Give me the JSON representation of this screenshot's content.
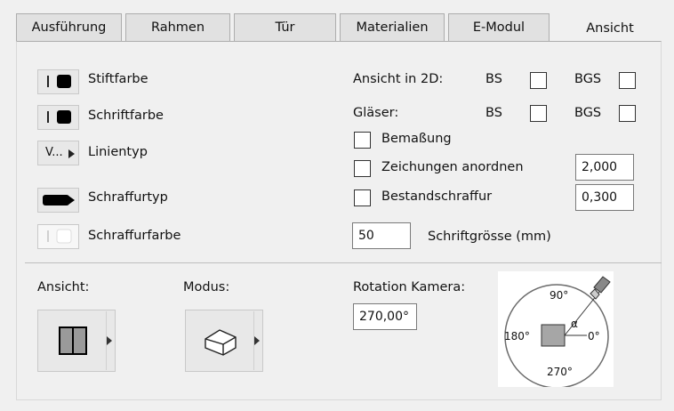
{
  "tabs": [
    {
      "label": "Ausführung"
    },
    {
      "label": "Rahmen"
    },
    {
      "label": "Tür"
    },
    {
      "label": "Materialien"
    },
    {
      "label": "E-Modul"
    },
    {
      "label": "Ansicht",
      "active": true
    }
  ],
  "left": {
    "pen_color": "Stiftfarbe",
    "font_color": "Schriftfarbe",
    "line_type_button": "V...",
    "line_type": "Linientyp",
    "hatch_type": "Schraffurtyp",
    "hatch_color": "Schraffurfarbe"
  },
  "right": {
    "view_2d_label": "Ansicht in 2D:",
    "glass_label": "Gläser:",
    "bs": "BS",
    "bgs": "BGS",
    "dimension": "Bemaßung",
    "arrange_drawings": "Zeichungen anordnen",
    "existing_hatch": "Bestandschraffur",
    "arrange_value": "2,000",
    "hatch_value": "0,300",
    "font_size_value": "50",
    "font_size_label": "Schriftgrösse (mm)"
  },
  "bottom": {
    "view_label": "Ansicht:",
    "mode_label": "Modus:",
    "rotation_label": "Rotation Kamera:",
    "rotation_value": "270,00°",
    "dial": {
      "top": "90°",
      "left": "180°",
      "right": "0°",
      "bottom": "270°",
      "alpha": "α"
    }
  }
}
